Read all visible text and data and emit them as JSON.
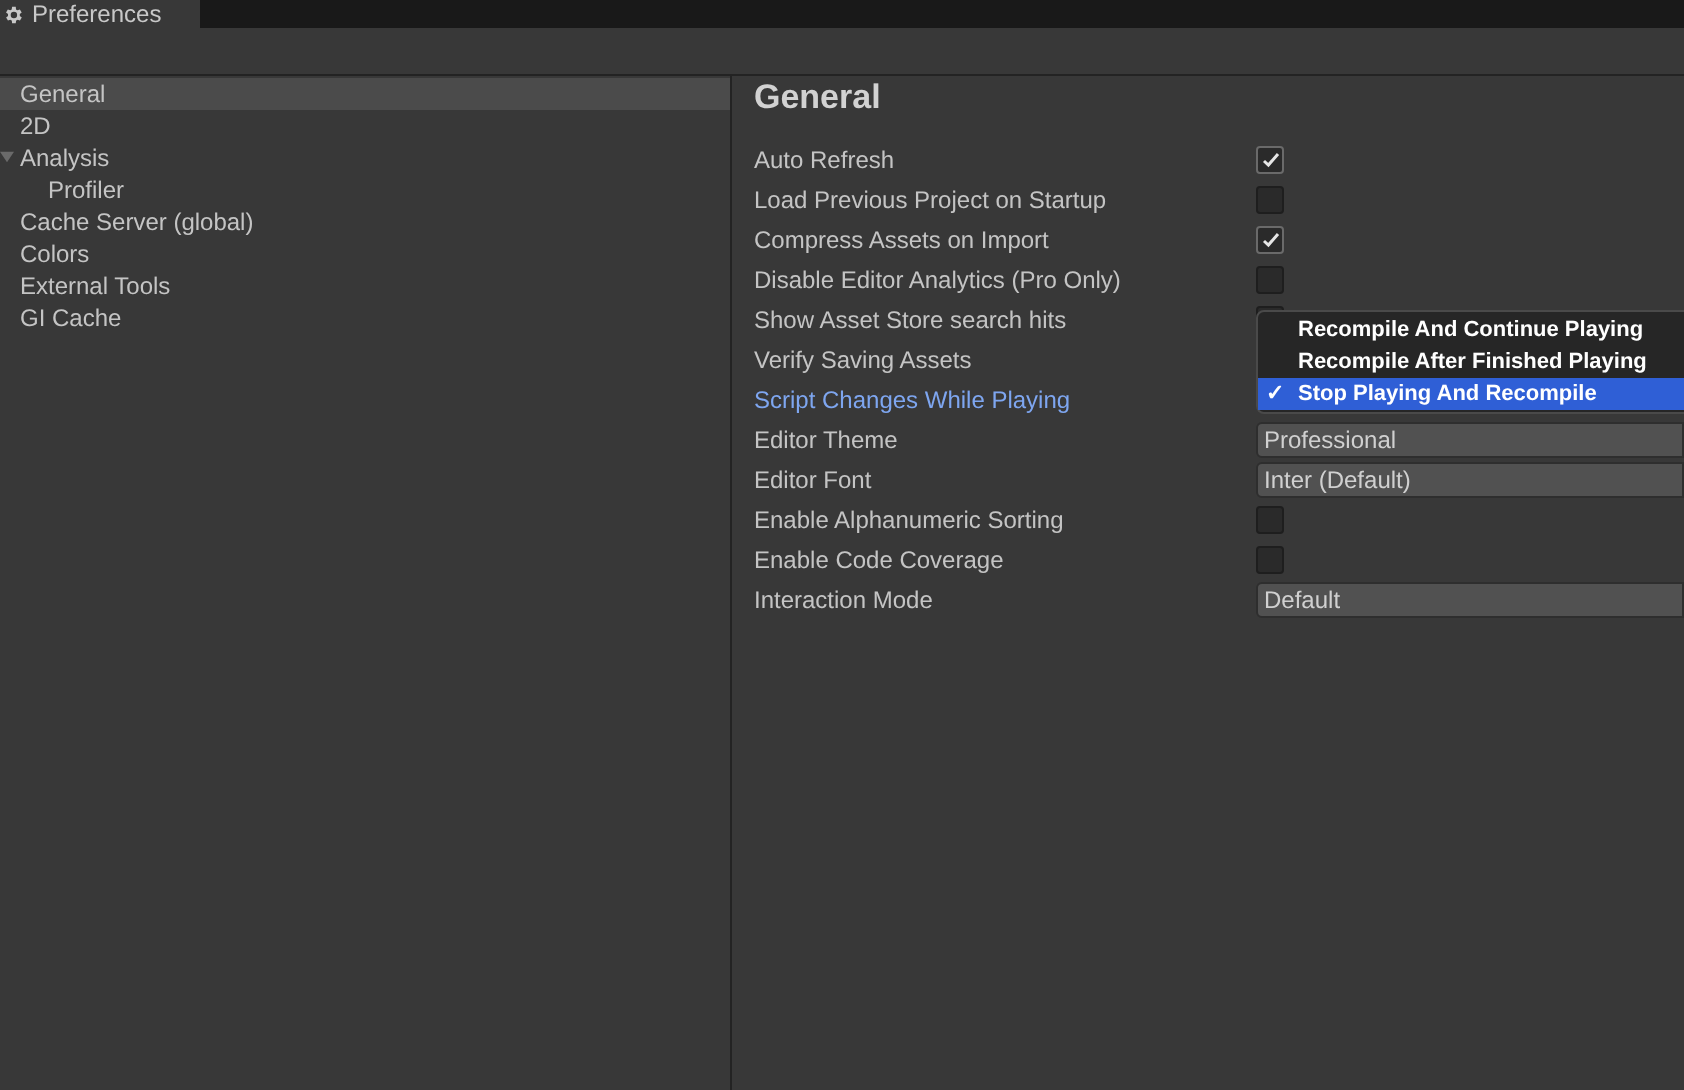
{
  "window": {
    "title": "Preferences"
  },
  "sidebar": {
    "items": [
      {
        "label": "General",
        "selected": true
      },
      {
        "label": "2D",
        "selected": false
      },
      {
        "label": "Analysis",
        "selected": false,
        "expanded": true,
        "children": [
          {
            "label": "Profiler",
            "selected": false
          }
        ]
      },
      {
        "label": "Cache Server (global)",
        "selected": false
      },
      {
        "label": "Colors",
        "selected": false
      },
      {
        "label": "External Tools",
        "selected": false
      },
      {
        "label": "GI Cache",
        "selected": false
      }
    ]
  },
  "panel": {
    "title": "General",
    "rows": [
      {
        "label": "Auto Refresh",
        "kind": "checkbox",
        "checked": true,
        "active": false
      },
      {
        "label": "Load Previous Project on Startup",
        "kind": "checkbox",
        "checked": false,
        "active": false
      },
      {
        "label": "Compress Assets on Import",
        "kind": "checkbox",
        "checked": true,
        "active": false
      },
      {
        "label": "Disable Editor Analytics (Pro Only)",
        "kind": "checkbox",
        "checked": false,
        "active": false
      },
      {
        "label": "Show Asset Store search hits",
        "kind": "checkbox",
        "checked": false,
        "active": false
      },
      {
        "label": "Verify Saving Assets",
        "kind": "covered",
        "active": false
      },
      {
        "label": "Script Changes While Playing",
        "kind": "covered",
        "active": true
      },
      {
        "label": "Editor Theme",
        "kind": "dropdown",
        "value": "Professional",
        "active": false
      },
      {
        "label": "Editor Font",
        "kind": "dropdown",
        "value": "Inter (Default)",
        "active": false
      },
      {
        "label": "Enable Alphanumeric Sorting",
        "kind": "checkbox",
        "checked": false,
        "active": false
      },
      {
        "label": "Enable Code Coverage",
        "kind": "checkbox",
        "checked": false,
        "active": false
      },
      {
        "label": "Interaction Mode",
        "kind": "dropdown",
        "value": "Default",
        "active": false
      }
    ]
  },
  "menu": {
    "items": [
      {
        "label": "Recompile And Continue Playing",
        "selected": false
      },
      {
        "label": "Recompile After Finished Playing",
        "selected": false
      },
      {
        "label": "Stop Playing And Recompile",
        "selected": true
      }
    ],
    "check": "✓"
  }
}
